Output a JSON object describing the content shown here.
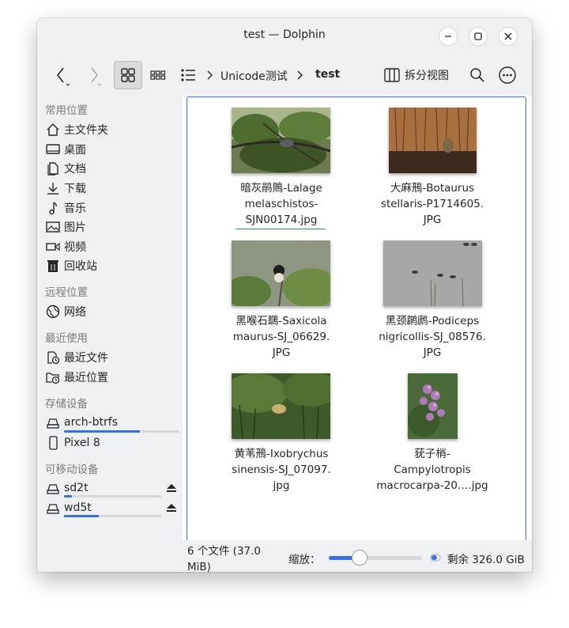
{
  "window": {
    "title": "test — Dolphin"
  },
  "toolbar": {
    "back_icon": "chevron-left-icon",
    "forward_icon": "chevron-right-icon",
    "breadcrumb": [
      "Unicode测试",
      "test"
    ],
    "split_label": "拆分视图",
    "search_icon": "search-icon",
    "menu_icon": "more-icon",
    "view_modes": [
      "icons-view",
      "compact-view",
      "details-view"
    ],
    "active_view": "icons-view"
  },
  "sidebar": {
    "sections": [
      {
        "title": "常用位置",
        "items": [
          {
            "label": "主文件夹",
            "icon": "home-icon"
          },
          {
            "label": "桌面",
            "icon": "desktop-icon"
          },
          {
            "label": "文档",
            "icon": "documents-icon"
          },
          {
            "label": "下载",
            "icon": "download-icon"
          },
          {
            "label": "音乐",
            "icon": "music-icon"
          },
          {
            "label": "图片",
            "icon": "pictures-icon"
          },
          {
            "label": "视频",
            "icon": "video-icon"
          },
          {
            "label": "回收站",
            "icon": "trash-icon"
          }
        ]
      },
      {
        "title": "远程位置",
        "items": [
          {
            "label": "网络",
            "icon": "network-icon"
          }
        ]
      },
      {
        "title": "最近使用",
        "items": [
          {
            "label": "最近文件",
            "icon": "recent-files-icon"
          },
          {
            "label": "最近位置",
            "icon": "recent-locations-icon"
          }
        ]
      },
      {
        "title": "存储设备",
        "items": [
          {
            "label": "arch-btrfs",
            "icon": "drive-icon",
            "usage": 0.66
          },
          {
            "label": "Pixel 8",
            "icon": "phone-icon"
          }
        ]
      },
      {
        "title": "可移动设备",
        "items": [
          {
            "label": "sd2t",
            "icon": "drive-icon",
            "usage": 0.08,
            "eject": true
          },
          {
            "label": "wd5t",
            "icon": "drive-icon",
            "usage": 0.36,
            "eject": true
          }
        ]
      }
    ]
  },
  "files": [
    {
      "label": "暗灰鹃鵙-Lalage\nmelaschistos-\nSJN00174.jpg",
      "selected": true
    },
    {
      "label": "大麻鳽-Botaurus\nstellaris-P1714605.\nJPG",
      "selected": false
    },
    {
      "label": "黑喉石䳭-Saxicola\nmaurus-SJ_06629.\nJPG",
      "selected": false
    },
    {
      "label": "黑颈䴙䴘-Podiceps\nnigricollis-SJ_08576.\nJPG",
      "selected": false
    },
    {
      "label": "黄苇鳽-Ixobrychus\nsinensis-SJ_07097.\njpg",
      "selected": false
    },
    {
      "label": "莸子梢-\nCampylotropis\nmacrocarpa-20….jpg",
      "selected": false
    }
  ],
  "status": {
    "summary": "6 个文件 (37.0\nMiB)",
    "zoom_label": "缩放：",
    "zoom_level": 0.33,
    "free_space": "剩余 326.0 GiB"
  },
  "colors": {
    "accent": "#3e6ee0",
    "window_bg": "#eff0f1",
    "view_bg": "#ffffff",
    "text": "#232629",
    "muted": "#7b7e82"
  }
}
